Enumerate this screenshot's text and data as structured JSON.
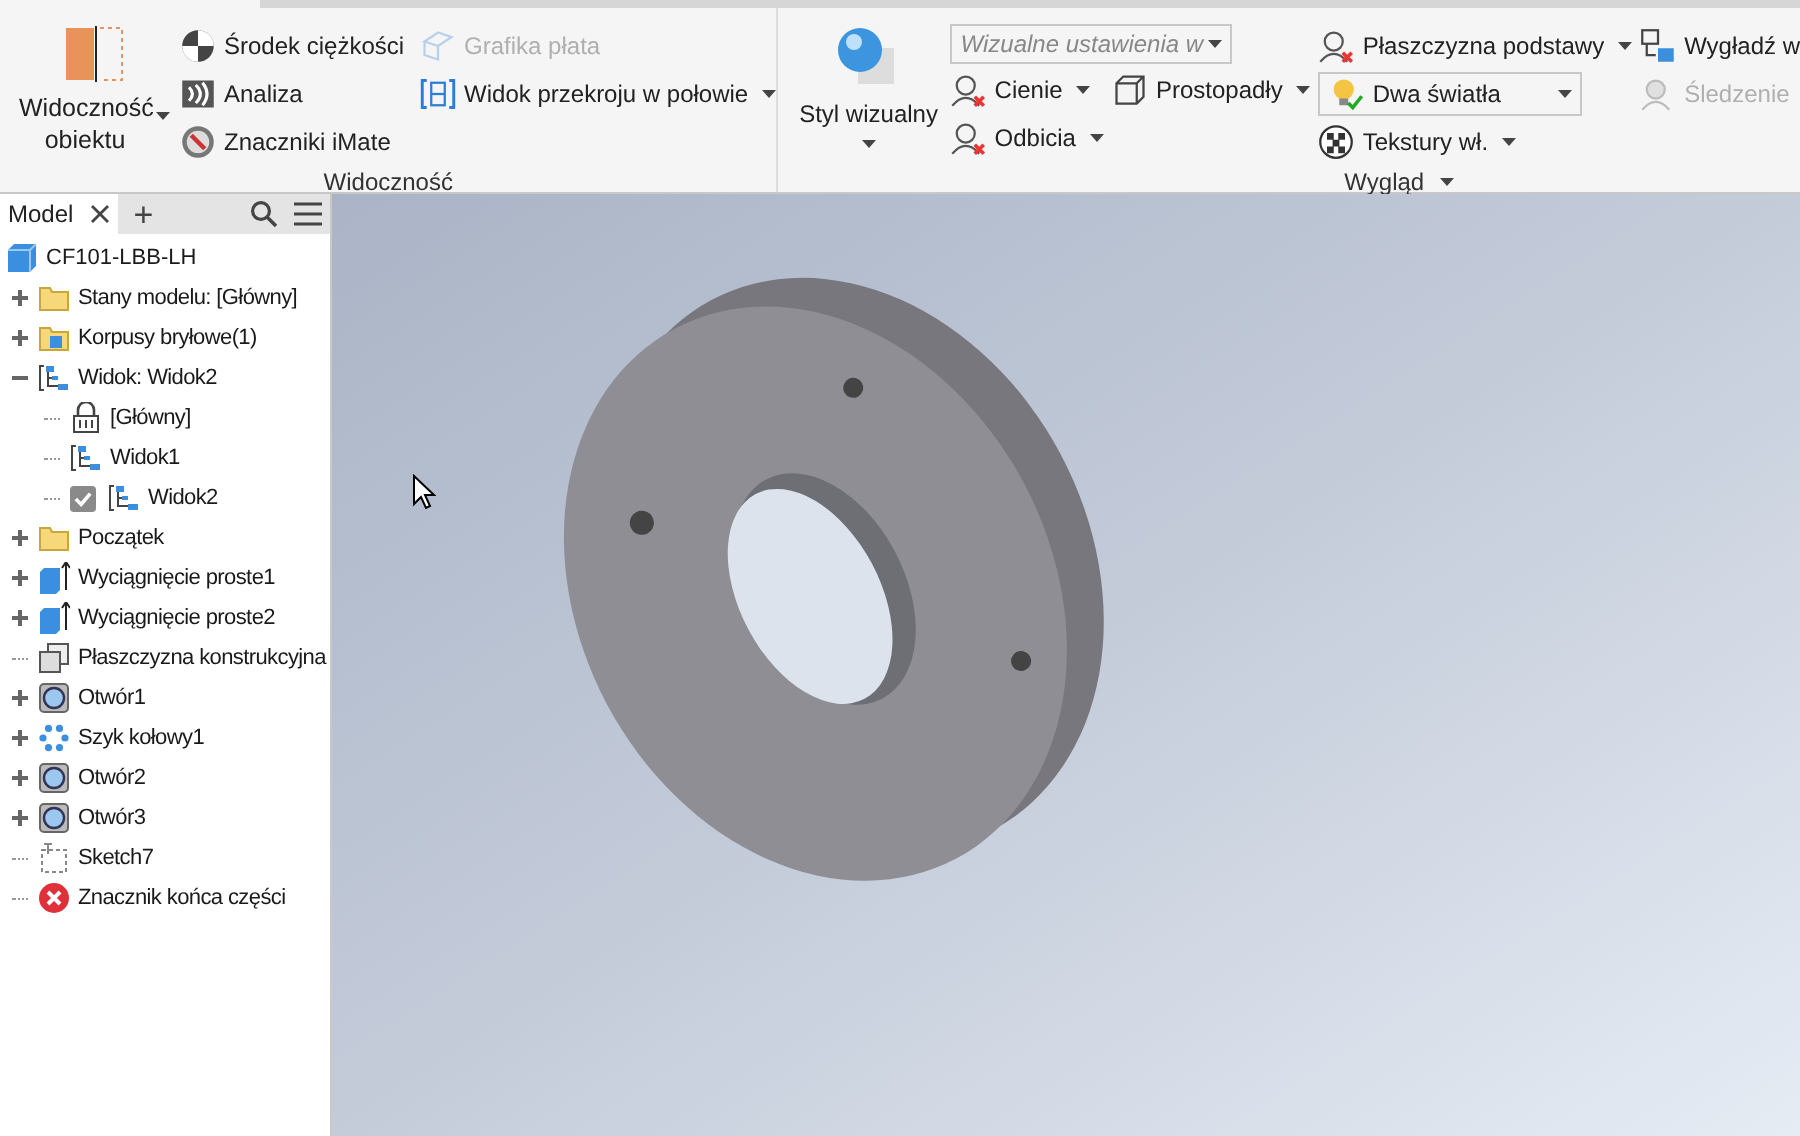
{
  "ribbon": {
    "visibility": {
      "title": "Widoczność",
      "large_button": {
        "label": "Widoczność obiektu"
      },
      "columns": [
        [
          {
            "label": "Środek ciężkości",
            "disabled": false,
            "dropdown": false
          },
          {
            "label": "Analiza",
            "disabled": false,
            "dropdown": false
          },
          {
            "label": "Znaczniki iMate",
            "disabled": false,
            "dropdown": false
          }
        ],
        [
          {
            "label": "Grafika płata",
            "disabled": true,
            "dropdown": false
          },
          {
            "label": "Widok przekroju w połowie",
            "disabled": false,
            "dropdown": true
          }
        ]
      ]
    },
    "appearance": {
      "title": "Wygląd",
      "title_dropdown": true,
      "large_button": {
        "label": "Styl wizualny"
      },
      "combo": {
        "value": "Wizualne ustawienia w"
      },
      "columns": [
        [
          {
            "label": "Cienie",
            "disabled": false,
            "dropdown": true
          },
          {
            "label": "Odbicia",
            "disabled": false,
            "dropdown": true
          }
        ],
        [
          {
            "label": "Prostopadły",
            "disabled": false,
            "dropdown": true
          }
        ],
        [
          {
            "label": "Płaszczyzna podstawy",
            "disabled": false,
            "dropdown": true
          },
          {
            "label": "Dwa światła",
            "kind": "combo"
          },
          {
            "label": "Tekstury wł.",
            "disabled": false,
            "dropdown": true
          }
        ],
        [
          {
            "label": "Wygładź w",
            "disabled": false,
            "dropdown": false
          },
          {
            "label": "Śledzenie",
            "disabled": true,
            "dropdown": false
          }
        ]
      ]
    }
  },
  "browser": {
    "tabs": [
      {
        "label": "Model",
        "selected": true,
        "closable": true
      }
    ],
    "add_tab": "+",
    "tree": [
      {
        "label": "CF101-LBB-LH",
        "kind": "part",
        "children": [
          {
            "label": "Stany modelu: [Główny]",
            "kind": "folder",
            "expanded": false
          },
          {
            "label": "Korpusy bryłowe(1)",
            "kind": "bodies",
            "expanded": false
          },
          {
            "label": "Widok: Widok2",
            "kind": "view",
            "expanded": true,
            "children": [
              {
                "label": "[Główny]",
                "kind": "lock"
              },
              {
                "label": "Widok1",
                "kind": "view"
              },
              {
                "label": "Widok2",
                "kind": "view",
                "checked": true
              }
            ]
          },
          {
            "label": "Początek",
            "kind": "folder",
            "expanded": false
          },
          {
            "label": "Wyciągnięcie proste1",
            "kind": "extrude",
            "expanded": false
          },
          {
            "label": "Wyciągnięcie proste2",
            "kind": "extrude",
            "expanded": false
          },
          {
            "label": "Płaszczyzna konstrukcyjna",
            "kind": "plane"
          },
          {
            "label": "Otwór1",
            "kind": "hole",
            "expanded": false
          },
          {
            "label": "Szyk kołowy1",
            "kind": "pattern",
            "expanded": false
          },
          {
            "label": "Otwór2",
            "kind": "hole",
            "expanded": false
          },
          {
            "label": "Otwór3",
            "kind": "hole",
            "expanded": false
          },
          {
            "label": "Sketch7",
            "kind": "sketch"
          },
          {
            "label": "Znacznik końca części",
            "kind": "end"
          }
        ]
      }
    ]
  }
}
